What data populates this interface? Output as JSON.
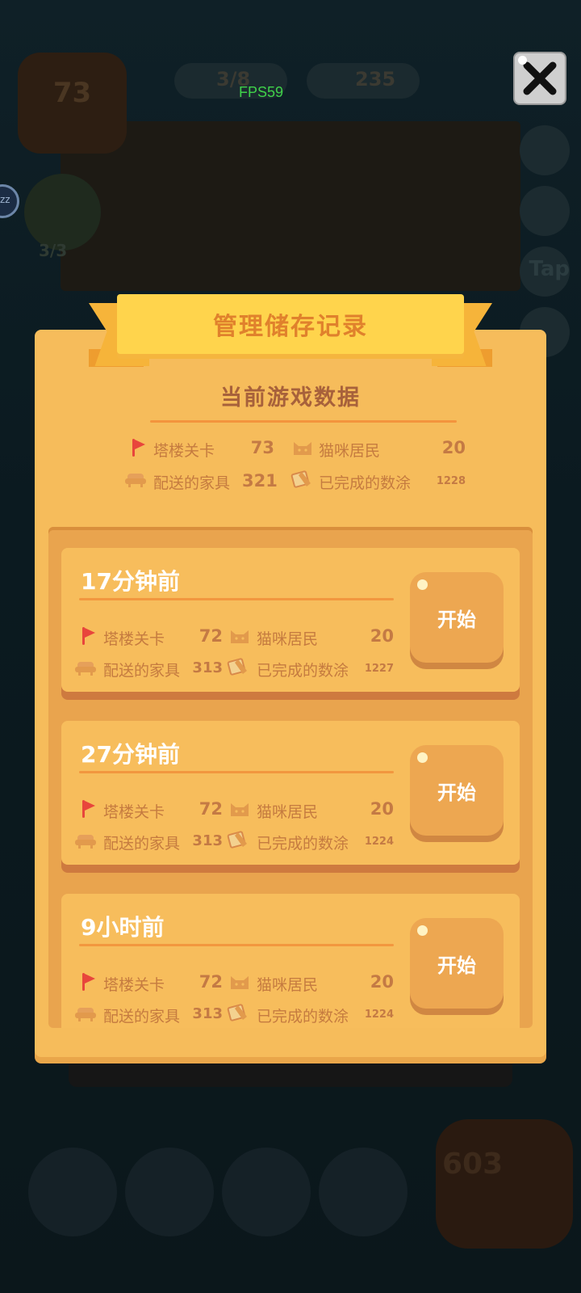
{
  "hud": {
    "fps": "FPS59",
    "close_icon": "close-icon"
  },
  "background": {
    "tower_level": "73",
    "counter_a": "3/8",
    "counter_b": "235",
    "task_progress": "3/3",
    "tap_hint": "Tap",
    "coins": "603",
    "sleep_icon_text": "zz"
  },
  "dialog": {
    "title": "管理储存记录",
    "current_title": "当前游戏数据",
    "current": {
      "tower_label": "塔楼关卡",
      "tower_value": "73",
      "cat_label": "猫咪居民",
      "cat_value": "20",
      "furniture_label": "配送的家具",
      "furniture_value": "321",
      "paint_label": "已完成的数涂",
      "paint_value": "1228"
    },
    "saves": [
      {
        "time": "17分钟前",
        "tower_label": "塔楼关卡",
        "tower_value": "72",
        "cat_label": "猫咪居民",
        "cat_value": "20",
        "furniture_label": "配送的家具",
        "furniture_value": "313",
        "paint_label": "已完成的数涂",
        "paint_value": "1227",
        "button": "开始"
      },
      {
        "time": "27分钟前",
        "tower_label": "塔楼关卡",
        "tower_value": "72",
        "cat_label": "猫咪居民",
        "cat_value": "20",
        "furniture_label": "配送的家具",
        "furniture_value": "313",
        "paint_label": "已完成的数涂",
        "paint_value": "1224",
        "button": "开始"
      },
      {
        "time": "9小时前",
        "tower_label": "塔楼关卡",
        "tower_value": "72",
        "cat_label": "猫咪居民",
        "cat_value": "20",
        "furniture_label": "配送的家具",
        "furniture_value": "313",
        "paint_label": "已完成的数涂",
        "paint_value": "1224",
        "button": "开始"
      }
    ]
  },
  "colors": {
    "dialog_bg": "#f6bc5b",
    "ribbon": "#ffd44c",
    "title_text": "#e0812c",
    "stat_text": "#c57b40",
    "flag": "#e8453c"
  }
}
